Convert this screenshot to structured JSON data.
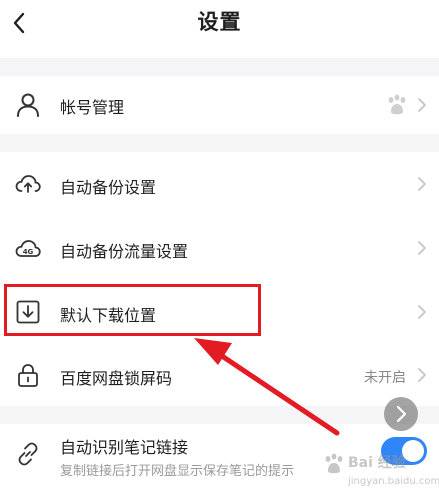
{
  "header": {
    "title": "设置",
    "back_icon": "chevron-left-icon"
  },
  "account": {
    "label": "帐号管理",
    "icon": "user-icon",
    "right_icon": "baidu-paw-icon"
  },
  "backup": {
    "items": [
      {
        "label": "自动备份设置",
        "icon": "cloud-upload-icon"
      },
      {
        "label": "自动备份流量设置",
        "icon": "cloud-4g-icon"
      },
      {
        "label": "默认下载位置",
        "icon": "download-icon"
      },
      {
        "label": "百度网盘锁屏码",
        "icon": "lock-icon",
        "value": "未开启"
      }
    ]
  },
  "notes": {
    "label": "自动识别笔记链接",
    "description": "复制链接后打开网盘显示保存笔记的提示",
    "icon": "link-icon",
    "toggle_on": true
  },
  "watermark": {
    "brand": "Bai 经验",
    "url": "jingyan.baidu.com"
  },
  "colors": {
    "accent_blue": "#2f86f6",
    "annotation_red": "#e31b23",
    "background": "#f5f5f7"
  }
}
